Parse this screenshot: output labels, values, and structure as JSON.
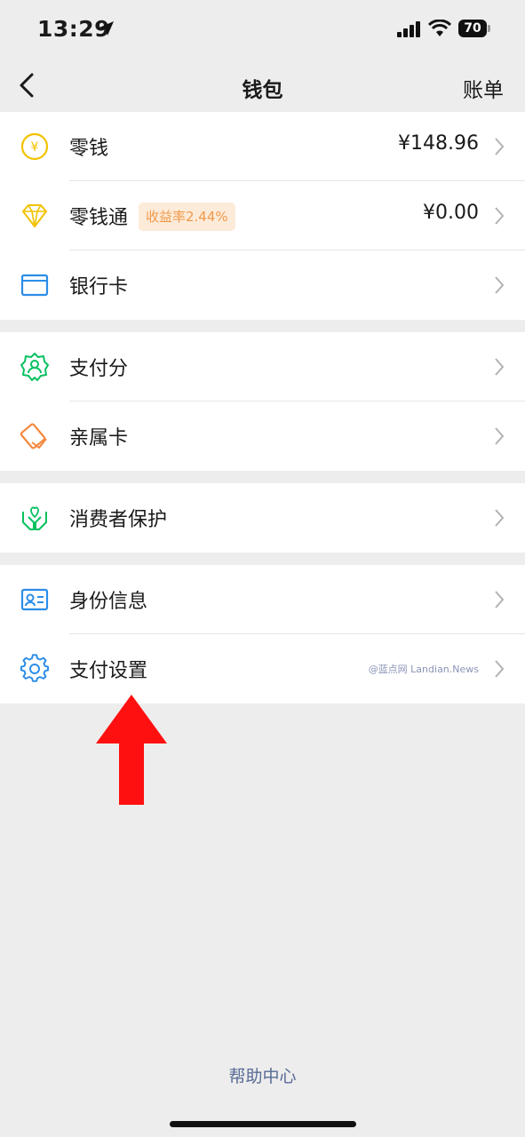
{
  "status": {
    "time": "13:29",
    "battery": "70"
  },
  "nav": {
    "title": "钱包",
    "bill": "账单"
  },
  "group1": [
    {
      "label": "零钱",
      "value": "¥148.96",
      "icon": "yuan-coin-icon"
    },
    {
      "label": "零钱通",
      "badge": "收益率2.44%",
      "value": "¥0.00",
      "icon": "diamond-icon"
    },
    {
      "label": "银行卡",
      "icon": "bank-card-icon"
    }
  ],
  "group2": [
    {
      "label": "支付分",
      "icon": "badge-person-icon"
    },
    {
      "label": "亲属卡",
      "icon": "family-card-icon"
    }
  ],
  "group3": [
    {
      "label": "消费者保护",
      "icon": "hands-protect-icon"
    }
  ],
  "group4": [
    {
      "label": "身份信息",
      "icon": "id-card-icon"
    },
    {
      "label": "支付设置",
      "icon": "gear-icon",
      "watermark": "@蓝点网 Landian.News"
    }
  ],
  "footer": {
    "help": "帮助中心"
  },
  "colors": {
    "background": "#ededed",
    "link": "#576b95",
    "badge_bg": "#fdebd9",
    "badge_text": "#f0994a",
    "arrow": "#ff1010"
  }
}
